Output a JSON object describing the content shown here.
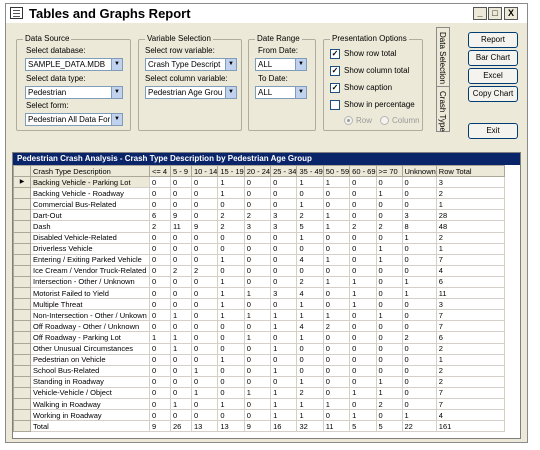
{
  "window": {
    "title": "Tables and Graphs Report",
    "controls": [
      "_",
      "□",
      "X"
    ]
  },
  "data_source": {
    "title": "Data Source",
    "database_label": "Select database:",
    "database_value": "SAMPLE_DATA.MDB",
    "datatype_label": "Select data type:",
    "datatype_value": "Pedestrian",
    "form_label": "Select form:",
    "form_value": "Pedestrian All Data For"
  },
  "variable_selection": {
    "title": "Variable Selection",
    "row_label": "Select row variable:",
    "row_value": "Crash Type Descript",
    "column_label": "Select column variable:",
    "column_value": "Pedestrian Age Grou"
  },
  "date_range": {
    "title": "Date Range",
    "from_label": "From Date:",
    "from_value": "ALL",
    "to_label": "To Date:",
    "to_value": "ALL"
  },
  "presentation": {
    "title": "Presentation Options",
    "options": [
      {
        "label": "Show row total",
        "checked": true
      },
      {
        "label": "Show column total",
        "checked": true
      },
      {
        "label": "Show caption",
        "checked": true
      },
      {
        "label": "Show in percentage",
        "checked": false
      }
    ],
    "radios": [
      {
        "label": "Row",
        "selected": true
      },
      {
        "label": "Column",
        "selected": false
      }
    ]
  },
  "tabs": [
    "Data Selection",
    "Crash Type"
  ],
  "buttons": {
    "report": "Report",
    "bar_chart": "Bar Chart",
    "excel": "Excel",
    "copy_chart": "Copy Chart",
    "exit": "Exit"
  },
  "grid": {
    "caption": "Pedestrian Crash Analysis - Crash Type Description by Pedestrian Age Group",
    "columns": [
      "Crash Type Description",
      "<= 4",
      "5 - 9",
      "10 - 14",
      "15 - 19",
      "20 - 24",
      "25 - 34",
      "35 - 49",
      "50 - 59",
      "60 - 69",
      ">= 70",
      "Unknown",
      "Row Total"
    ],
    "rows": [
      [
        "Backing Vehicle - Parking Lot",
        "0",
        "0",
        "0",
        "1",
        "0",
        "0",
        "1",
        "1",
        "0",
        "0",
        "0",
        "3"
      ],
      [
        "Backing Vehicle - Roadway",
        "0",
        "0",
        "0",
        "1",
        "0",
        "0",
        "0",
        "0",
        "0",
        "1",
        "0",
        "2"
      ],
      [
        "Commercial Bus-Related",
        "0",
        "0",
        "0",
        "0",
        "0",
        "0",
        "1",
        "0",
        "0",
        "0",
        "0",
        "1"
      ],
      [
        "Dart-Out",
        "6",
        "9",
        "0",
        "2",
        "2",
        "3",
        "2",
        "1",
        "0",
        "0",
        "3",
        "28"
      ],
      [
        "Dash",
        "2",
        "11",
        "9",
        "2",
        "3",
        "3",
        "5",
        "1",
        "2",
        "2",
        "8",
        "48"
      ],
      [
        "Disabled Vehicle-Related",
        "0",
        "0",
        "0",
        "0",
        "0",
        "0",
        "1",
        "0",
        "0",
        "0",
        "1",
        "2"
      ],
      [
        "Driverless Vehicle",
        "0",
        "0",
        "0",
        "0",
        "0",
        "0",
        "0",
        "0",
        "0",
        "1",
        "0",
        "1"
      ],
      [
        "Entering / Exiting Parked Vehicle",
        "0",
        "0",
        "0",
        "1",
        "0",
        "0",
        "4",
        "1",
        "0",
        "1",
        "0",
        "7"
      ],
      [
        "Ice Cream / Vendor Truck-Related",
        "0",
        "2",
        "2",
        "0",
        "0",
        "0",
        "0",
        "0",
        "0",
        "0",
        "0",
        "4"
      ],
      [
        "Intersection - Other / Unknown",
        "0",
        "0",
        "0",
        "1",
        "0",
        "0",
        "2",
        "1",
        "1",
        "0",
        "1",
        "6"
      ],
      [
        "Motorist Failed to Yield",
        "0",
        "0",
        "0",
        "1",
        "1",
        "3",
        "4",
        "0",
        "1",
        "0",
        "1",
        "11"
      ],
      [
        "Multiple Threat",
        "0",
        "0",
        "0",
        "1",
        "0",
        "0",
        "1",
        "0",
        "1",
        "0",
        "0",
        "3"
      ],
      [
        "Non-Intersection - Other / Unkown",
        "0",
        "1",
        "0",
        "1",
        "1",
        "1",
        "1",
        "1",
        "0",
        "1",
        "0",
        "7"
      ],
      [
        "Off Roadway - Other / Unknown",
        "0",
        "0",
        "0",
        "0",
        "0",
        "1",
        "4",
        "2",
        "0",
        "0",
        "0",
        "7"
      ],
      [
        "Off Roadway - Parking Lot",
        "1",
        "1",
        "0",
        "0",
        "1",
        "0",
        "1",
        "0",
        "0",
        "0",
        "2",
        "6"
      ],
      [
        "Other Unusual Circumstances",
        "0",
        "1",
        "0",
        "0",
        "0",
        "1",
        "0",
        "0",
        "0",
        "0",
        "0",
        "2"
      ],
      [
        "Pedestrian on Vehicle",
        "0",
        "0",
        "0",
        "1",
        "0",
        "0",
        "0",
        "0",
        "0",
        "0",
        "0",
        "1"
      ],
      [
        "School Bus-Related",
        "0",
        "0",
        "1",
        "0",
        "0",
        "1",
        "0",
        "0",
        "0",
        "0",
        "0",
        "2"
      ],
      [
        "Standing in Roadway",
        "0",
        "0",
        "0",
        "0",
        "0",
        "0",
        "1",
        "0",
        "0",
        "1",
        "0",
        "2"
      ],
      [
        "Vehicle-Vehicle / Object",
        "0",
        "0",
        "1",
        "0",
        "1",
        "1",
        "2",
        "0",
        "1",
        "1",
        "0",
        "7"
      ],
      [
        "Walking in Roadway",
        "0",
        "1",
        "0",
        "1",
        "0",
        "1",
        "1",
        "1",
        "0",
        "2",
        "0",
        "7"
      ],
      [
        "Working in Roadway",
        "0",
        "0",
        "0",
        "0",
        "0",
        "1",
        "1",
        "0",
        "1",
        "0",
        "1",
        "4"
      ],
      [
        "Total",
        "9",
        "26",
        "13",
        "13",
        "9",
        "16",
        "32",
        "11",
        "5",
        "5",
        "22",
        "161"
      ]
    ],
    "current_row_marker": "▶"
  },
  "colors": {
    "caption_bg": "#0a246a",
    "window_bg": "#ece9d8"
  }
}
